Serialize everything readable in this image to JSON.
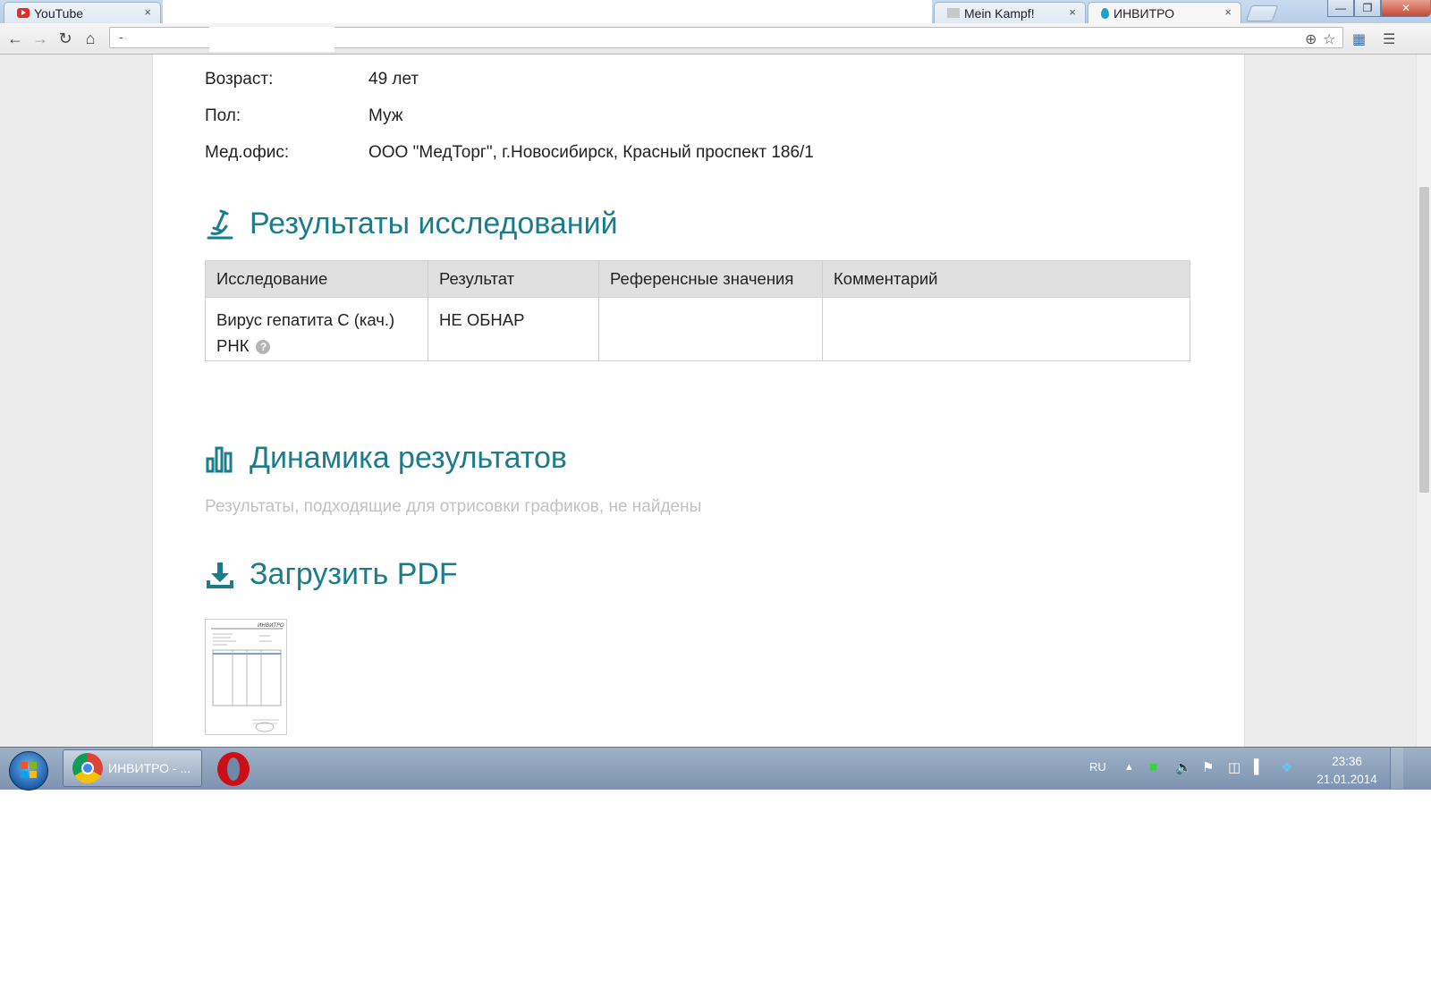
{
  "browser": {
    "tabs": [
      {
        "label": "YouTube",
        "icon": "youtube-icon"
      },
      {
        "label": "Mein Kampf!",
        "icon": "site-favicon-icon"
      },
      {
        "label": "ИНВИТРО",
        "icon": "invitro-drop-icon"
      }
    ],
    "close_glyph": "×",
    "address": "-"
  },
  "patient": {
    "age_label": "Возраст:",
    "age_value": "49 лет",
    "sex_label": "Пол:",
    "sex_value": "Муж",
    "office_label": "Мед.офис:",
    "office_value": "ООО \"МедТорг\", г.Новосибирск, Красный проспект 186/1"
  },
  "results_section": {
    "title": "Результаты исследований",
    "columns": [
      "Исследование",
      "Результат",
      "Референсные значения",
      "Комментарий"
    ],
    "rows": [
      {
        "test": "Вирус гепатита С (кач.) РНК",
        "result": "НЕ ОБНАР",
        "reference": "",
        "comment": ""
      }
    ],
    "help_glyph": "?"
  },
  "dynamics_section": {
    "title": "Динамика результатов",
    "empty_message": "Результаты, подходящие для отрисовки графиков, не найдены"
  },
  "pdf_section": {
    "title": "Загрузить PDF",
    "thumb_brand": "ИНВИТРО"
  },
  "taskbar": {
    "task_label": "ИНВИТРО - ...",
    "language": "RU",
    "time": "23:36",
    "date": "21.01.2014"
  },
  "colors": {
    "accent": "#1b7c8c",
    "muted_text": "#c2c2c2",
    "table_header_bg": "#e0e0e0"
  }
}
